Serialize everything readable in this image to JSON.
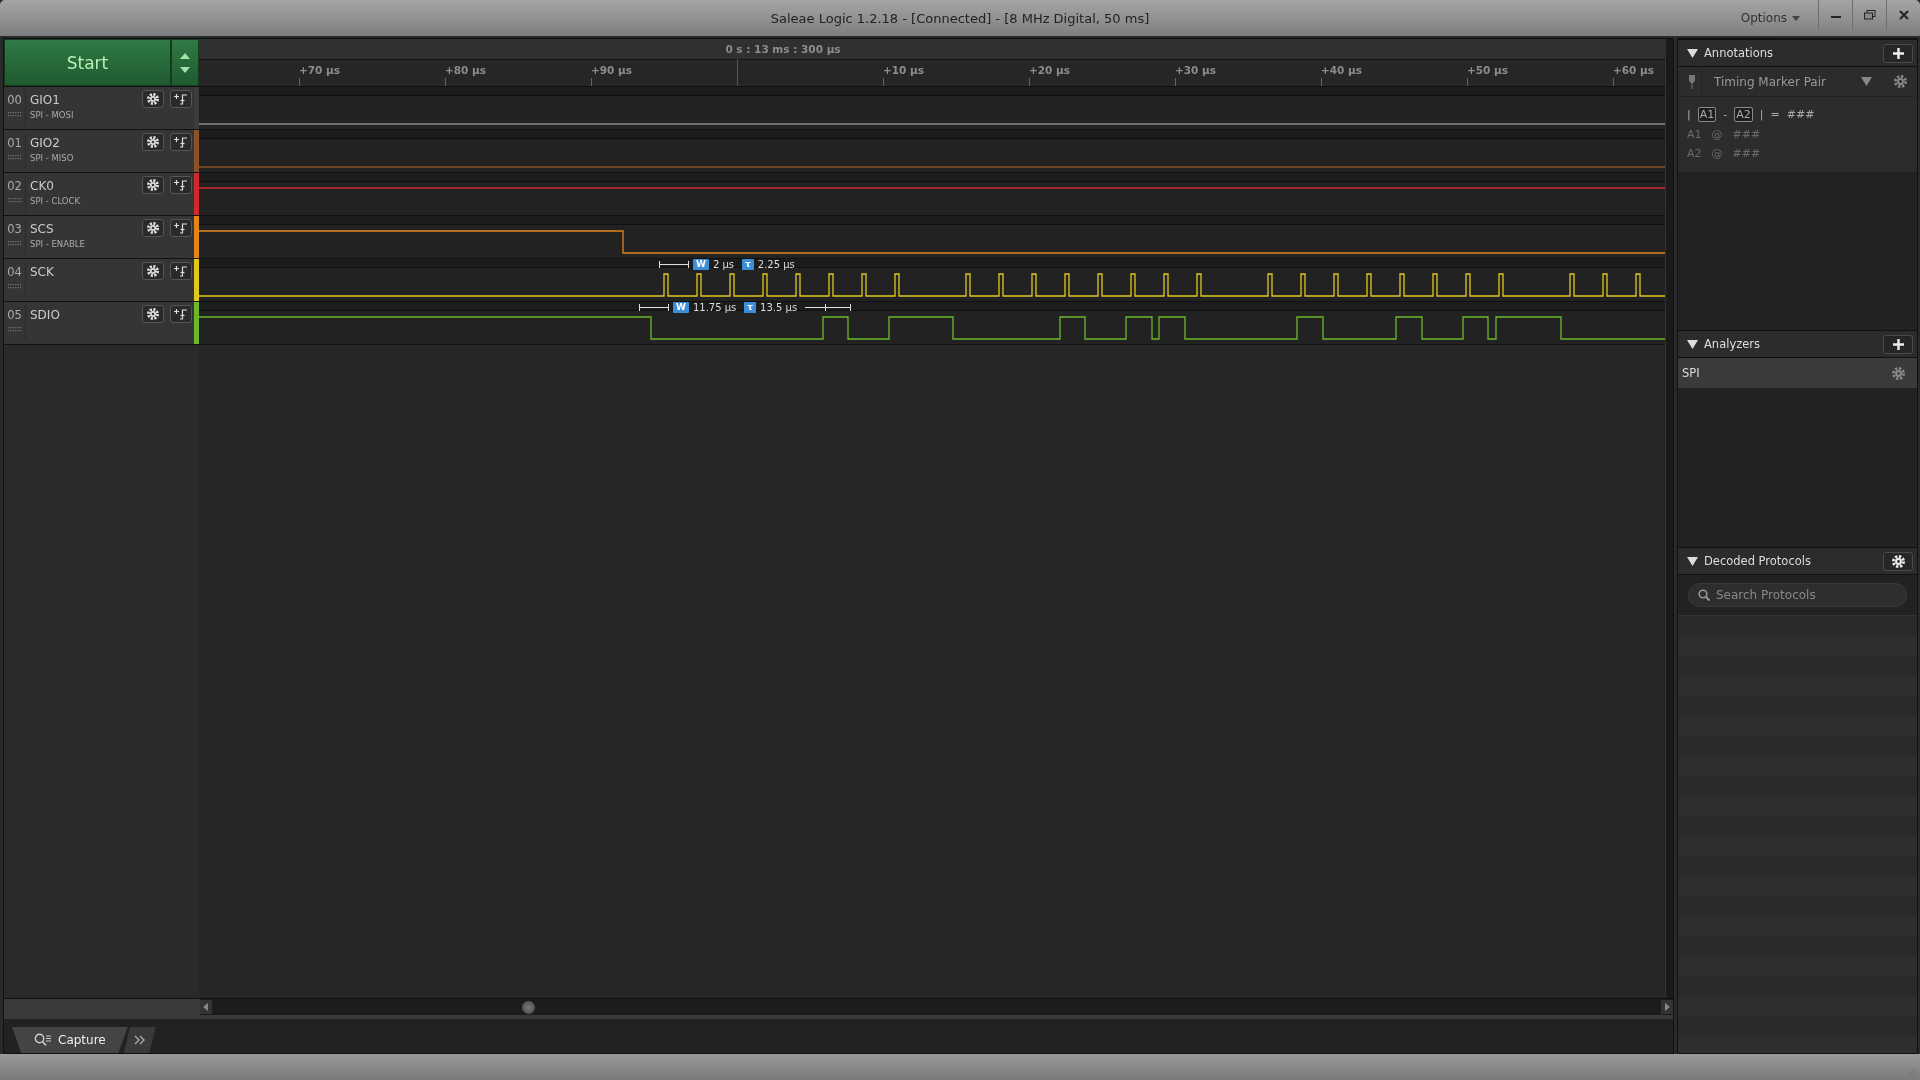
{
  "window": {
    "title": "Saleae Logic 1.2.18 - [Connected] - [8 MHz Digital, 50 ms]",
    "menu": "Options"
  },
  "start_button": {
    "label": "Start"
  },
  "timeline": {
    "cursor_time": "0 s : 13 ms : 300 µs",
    "ticks": [
      "+70 µs",
      "+80 µs",
      "+90 µs",
      "+10 µs",
      "+20 µs",
      "+30 µs",
      "+40 µs",
      "+50 µs",
      "+60 µs"
    ]
  },
  "channels": [
    {
      "number": "00",
      "name": "GIO1",
      "subtitle": "SPI - MOSI",
      "color": "#3c3c3c"
    },
    {
      "number": "01",
      "name": "GIO2",
      "subtitle": "SPI - MISO",
      "color": "#8a5226"
    },
    {
      "number": "02",
      "name": "CK0",
      "subtitle": "SPI - CLOCK",
      "color": "#d0282c"
    },
    {
      "number": "03",
      "name": "SCS",
      "subtitle": "SPI - ENABLE",
      "color": "#e0861a"
    },
    {
      "number": "04",
      "name": "SCK",
      "color": "#e2c81e",
      "measurements": [
        {
          "label": "W",
          "value": "2 µs"
        },
        {
          "label": "τ",
          "value": "2.25 µs"
        }
      ]
    },
    {
      "number": "05",
      "name": "SDIO",
      "color": "#6cb82a",
      "measurements": [
        {
          "label": "W",
          "value": "11.75 µs"
        },
        {
          "label": "τ",
          "value": "13.5 µs"
        }
      ]
    }
  ],
  "annotations": {
    "title": "Annotations",
    "marker_type": "Timing Marker Pair",
    "difference": {
      "open": "|",
      "a": "A1",
      "minus": "-",
      "b": "A2",
      "close": "|",
      "equals": "=",
      "value": "###"
    },
    "markers": [
      {
        "name": "A1",
        "at": "@",
        "value": "###"
      },
      {
        "name": "A2",
        "at": "@",
        "value": "###"
      }
    ]
  },
  "analyzers": {
    "title": "Analyzers",
    "items": [
      {
        "name": "SPI"
      }
    ]
  },
  "decoded_protocols": {
    "title": "Decoded Protocols",
    "search": {
      "placeholder": "Search Protocols"
    }
  },
  "bottom_tabs": [
    {
      "label": "Capture",
      "selected": true
    }
  ]
}
